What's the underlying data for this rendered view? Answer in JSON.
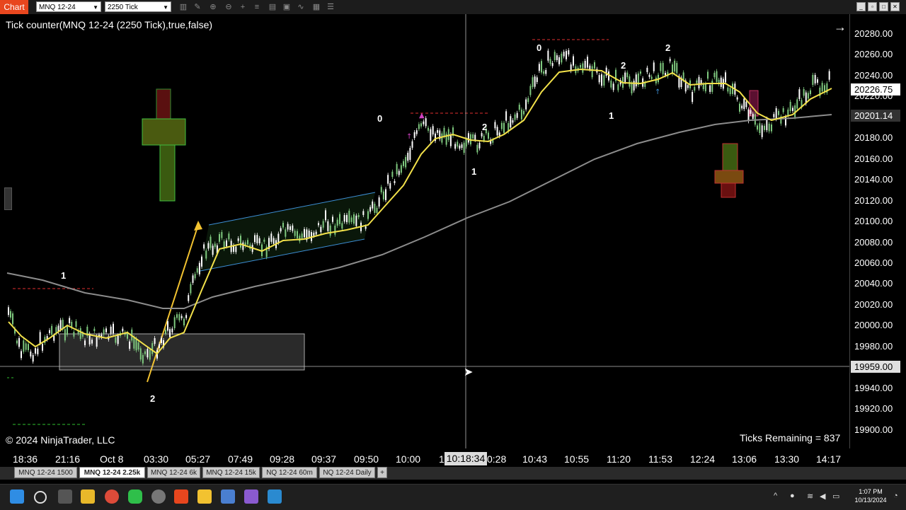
{
  "window": {
    "app_tab": "Chart",
    "instrument": "MNQ 12-24",
    "interval": "2250 Tick"
  },
  "indicator_title": "Tick counter(MNQ 12-24 (2250 Tick),true,false)",
  "copyright": "© 2024 NinjaTrader, LLC",
  "ticks_remaining": "Ticks Remaining = 837",
  "price_axis": {
    "labels": [
      "20280.00",
      "20260.00",
      "20240.00",
      "20220.00",
      "20200.00",
      "20180.00",
      "20160.00",
      "20140.00",
      "20120.00",
      "20100.00",
      "20080.00",
      "20060.00",
      "20040.00",
      "20020.00",
      "20000.00",
      "19980.00",
      "19960.00",
      "19940.00",
      "19920.00",
      "19900.00"
    ],
    "last_price": "20226.75",
    "ma_price": "20201.14",
    "crosshair_price": "19959.00"
  },
  "time_axis": {
    "labels": [
      "18:36",
      "21:16",
      "Oct 8",
      "03:30",
      "05:27",
      "07:49",
      "09:28",
      "09:37",
      "09:50",
      "10:00",
      "1",
      "0:28",
      "10:43",
      "10:55",
      "11:20",
      "11:53",
      "12:24",
      "13:06",
      "13:30",
      "14:17"
    ],
    "crosshair_time": "10:18:34"
  },
  "swing_labels": [
    "1",
    "2",
    "0",
    "1",
    "2",
    "0",
    "2",
    "1",
    "2"
  ],
  "tabs": [
    {
      "label": "MNQ 12-24 1500"
    },
    {
      "label": "MNQ 12-24 2.25k"
    },
    {
      "label": "MNQ 12-24 6k"
    },
    {
      "label": "MNQ 12-24 15k"
    },
    {
      "label": "NQ 12-24 60m"
    },
    {
      "label": "NQ 12-24 Daily"
    },
    {
      "label": "+"
    }
  ],
  "clock": {
    "time": "1:07 PM",
    "date": "10/13/2024"
  },
  "colors": {
    "accent": "#e8461e",
    "fast_ma": "#f2e14a",
    "slow_ma": "#8c8c8c",
    "up_bar": "#7fc97f",
    "down_bar": "#ffffff",
    "channel": "#3d8fd6",
    "swing_line": "#e03030"
  }
}
